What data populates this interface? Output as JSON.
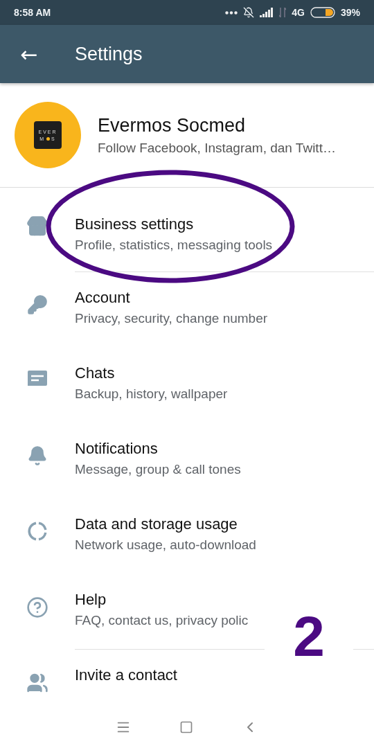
{
  "status_bar": {
    "time": "8:58 AM",
    "network": "4G",
    "battery": "39%"
  },
  "app_bar": {
    "back": "←",
    "title": "Settings"
  },
  "profile": {
    "logo_top": "EVER",
    "logo_bottom_left": "M",
    "logo_bottom_right": "S",
    "name": "Evermos Socmed",
    "about": "Follow Facebook, Instagram, dan Twitt…"
  },
  "items": [
    {
      "kind": "store",
      "title": "Business settings",
      "subtitle": "Profile, statistics, messaging tools",
      "section_end": true
    },
    {
      "kind": "key",
      "title": "Account",
      "subtitle": "Privacy, security, change number",
      "section_end": false
    },
    {
      "kind": "chat",
      "title": "Chats",
      "subtitle": "Backup, history, wallpaper",
      "section_end": false
    },
    {
      "kind": "bell",
      "title": "Notifications",
      "subtitle": "Message, group & call tones",
      "section_end": false
    },
    {
      "kind": "data",
      "title": "Data and storage usage",
      "subtitle": "Network usage, auto-download",
      "section_end": false
    },
    {
      "kind": "help",
      "title": "Help",
      "subtitle": "FAQ, contact us, privacy polic",
      "section_end": true
    },
    {
      "kind": "people",
      "title": "Invite a contact"
    }
  ],
  "annotation": {
    "label": "2"
  }
}
